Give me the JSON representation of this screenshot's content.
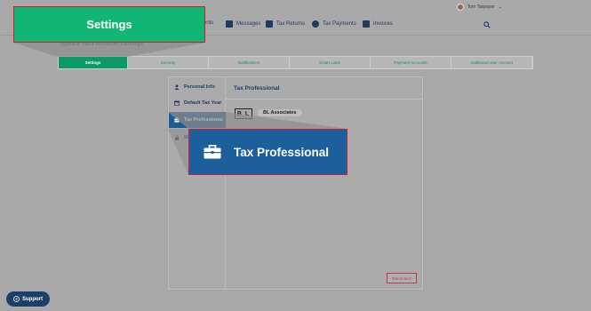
{
  "topbar": {
    "user_name": "Tom Taxpayer",
    "user_caret": "⌄"
  },
  "nav": {
    "items": [
      {
        "label": "ents",
        "icon": "documents-icon"
      },
      {
        "label": "Messages",
        "icon": "messages-icon"
      },
      {
        "label": "Tax Returns",
        "icon": "tax-returns-icon"
      },
      {
        "label": "Tax Payments",
        "icon": "tax-payments-icon"
      },
      {
        "label": "Invoices",
        "icon": "invoices-icon"
      }
    ],
    "search_icon": "search-icon"
  },
  "page": {
    "heading": "Update Your Account Settings"
  },
  "tabs": [
    {
      "label": "Settings",
      "active": true
    },
    {
      "label": "Security",
      "active": false
    },
    {
      "label": "Notifications",
      "active": false
    },
    {
      "label": "Smart Links",
      "active": false
    },
    {
      "label": "Payment Accounts",
      "active": false
    },
    {
      "label": "Additional User Account",
      "active": false
    }
  ],
  "sidebar": {
    "items": [
      {
        "label": "Personal Info",
        "icon": "person-icon",
        "active": false
      },
      {
        "label": "Default Tax Year",
        "icon": "calendar-icon",
        "active": false
      },
      {
        "label": "Tax Professional",
        "icon": "briefcase-icon",
        "active": true
      },
      {
        "label": "Bi",
        "icon": "lock-icon",
        "active": false
      }
    ]
  },
  "content": {
    "title": "Tax Professional",
    "logo_text": "B L",
    "firm_name": "BL Associates",
    "disconnect_label": "Disconnect"
  },
  "support": {
    "label": "Support"
  },
  "callouts": {
    "settings": "Settings",
    "tax_professional": "Tax Professional"
  },
  "colors": {
    "accent_green": "#12b573",
    "accent_blue": "#1c5f9c",
    "callout_border": "#d0202e",
    "nav_text": "#1e3a5f"
  }
}
